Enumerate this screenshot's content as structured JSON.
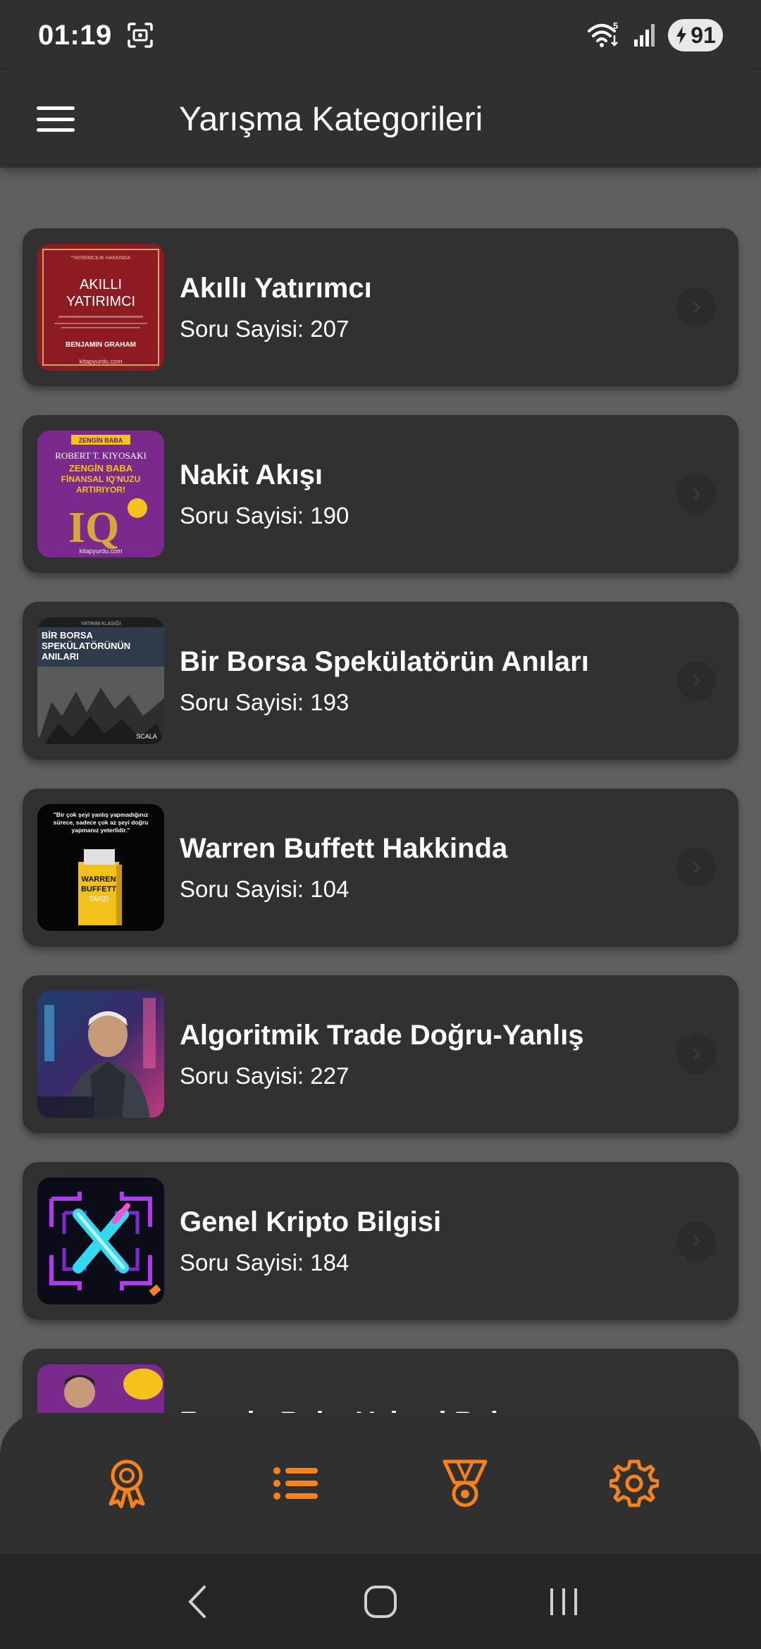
{
  "status_bar": {
    "time": "01:19",
    "battery": "91",
    "wifi_badge": "5"
  },
  "header": {
    "title": "Yarışma Kategorileri"
  },
  "categories": [
    {
      "title": "Akıllı Yatırımcı",
      "count_text": "Soru Sayisi: 207",
      "cover": {
        "top": "\"YATIRIMCILIK HAKKINDA",
        "line1": "AKILLI",
        "line2": "YATIRIMCI",
        "author": "BENJAMIN GRAHAM",
        "publisher": "kitapyurdu.com"
      }
    },
    {
      "title": "Nakit Akışı",
      "count_text": "Soru Sayisi: 190",
      "cover": {
        "brand": "ZENGİN BABA",
        "author": "ROBERT T. KIYOSAKI",
        "line1": "ZENGİN BABA",
        "line2": "FİNANSAL IQ'NUZU",
        "line3": "ARTIRIYOR!",
        "big": "IQ",
        "publisher": "kitapyurdu.com"
      }
    },
    {
      "title": "Bir Borsa Spekülatörün Anıları",
      "count_text": "Soru Sayisi: 193",
      "cover": {
        "top": "YATIRIM KLASİĞİ",
        "line1": "BİR BORSA",
        "line2": "SPEKÜLATÖRÜNÜN",
        "line3": "ANILARI",
        "publisher": "SCALA"
      }
    },
    {
      "title": "Warren Buffett Hakkinda",
      "count_text": "Soru Sayisi: 104",
      "cover": {
        "quote": "\"Bir çok şeyi yanlış yapmadığınız sürece, sadece çok az şeyi doğru yapmanız yeterlidir.\"",
        "book1": "WARREN",
        "book2": "BUFFETT",
        "book3": "TARZI"
      }
    },
    {
      "title": "Algoritmik Trade Doğru-Yanlış",
      "count_text": "Soru Sayisi: 227",
      "cover": {}
    },
    {
      "title": "Genel Kripto Bilgisi",
      "count_text": "Soru Sayisi: 184",
      "cover": {}
    },
    {
      "title": "Zengin Baba Yoksul Baba",
      "count_text": "",
      "cover": {}
    }
  ],
  "colors": {
    "accent": "#f7821b",
    "card": "#313131",
    "background": "#5f5f5f",
    "bar": "#303030"
  },
  "bottom_nav": [
    {
      "icon": "award-ribbon-icon"
    },
    {
      "icon": "list-icon"
    },
    {
      "icon": "medal-icon"
    },
    {
      "icon": "gear-icon"
    }
  ],
  "system_nav": [
    "back-icon",
    "home-icon",
    "recents-icon"
  ]
}
